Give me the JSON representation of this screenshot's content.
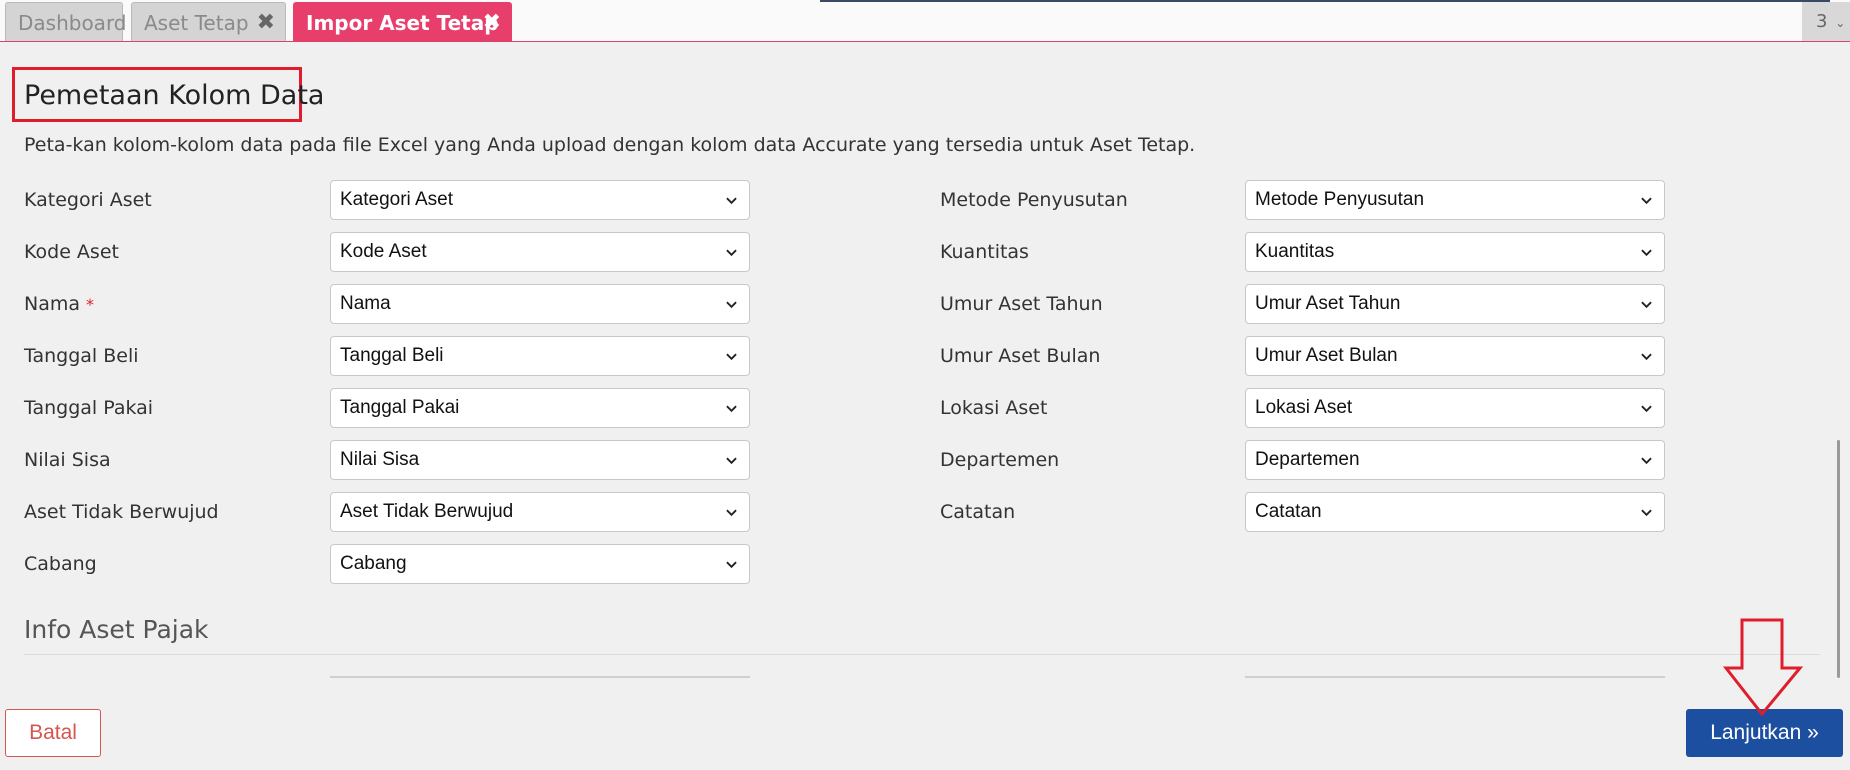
{
  "tabs": [
    {
      "label": "Dashboard",
      "closable": false,
      "active": false
    },
    {
      "label": "Aset Tetap",
      "closable": true,
      "active": false
    },
    {
      "label": "Impor Aset Tetap",
      "closable": true,
      "active": true
    }
  ],
  "tab_count": "3",
  "close_glyph": "✖",
  "page": {
    "title": "Pemetaan Kolom Data",
    "description": "Peta-kan kolom-kolom data pada file Excel yang Anda upload dengan kolom data Accurate yang tersedia untuk Aset Tetap."
  },
  "left_fields": [
    {
      "label": "Kategori Aset",
      "value": "Kategori Aset"
    },
    {
      "label": "Kode Aset",
      "value": "Kode Aset"
    },
    {
      "label": "Nama",
      "value": "Nama",
      "required": "*"
    },
    {
      "label": "Tanggal Beli",
      "value": "Tanggal Beli"
    },
    {
      "label": "Tanggal Pakai",
      "value": "Tanggal Pakai"
    },
    {
      "label": "Nilai Sisa",
      "value": "Nilai Sisa"
    },
    {
      "label": "Aset Tidak Berwujud",
      "value": "Aset Tidak Berwujud"
    },
    {
      "label": "Cabang",
      "value": "Cabang"
    }
  ],
  "right_fields": [
    {
      "label": "Metode Penyusutan",
      "value": "Metode Penyusutan"
    },
    {
      "label": "Kuantitas",
      "value": "Kuantitas"
    },
    {
      "label": "Umur Aset Tahun",
      "value": "Umur Aset Tahun"
    },
    {
      "label": "Umur Aset Bulan",
      "value": "Umur Aset Bulan"
    },
    {
      "label": "Lokasi Aset",
      "value": "Lokasi Aset"
    },
    {
      "label": "Departemen",
      "value": "Departemen"
    },
    {
      "label": "Catatan",
      "value": "Catatan"
    }
  ],
  "section": {
    "title": "Info Aset Pajak"
  },
  "footer": {
    "cancel_label": "Batal",
    "next_label": "Lanjutkan »"
  },
  "icons": {
    "select": "chevron-down-icon",
    "close": "close-icon",
    "annotation": "red-down-arrow"
  },
  "colors": {
    "accent_tab": "#e83e6c",
    "primary_button": "#1d4fa0",
    "cancel": "#d9534f",
    "highlight": "#e01e2b"
  }
}
